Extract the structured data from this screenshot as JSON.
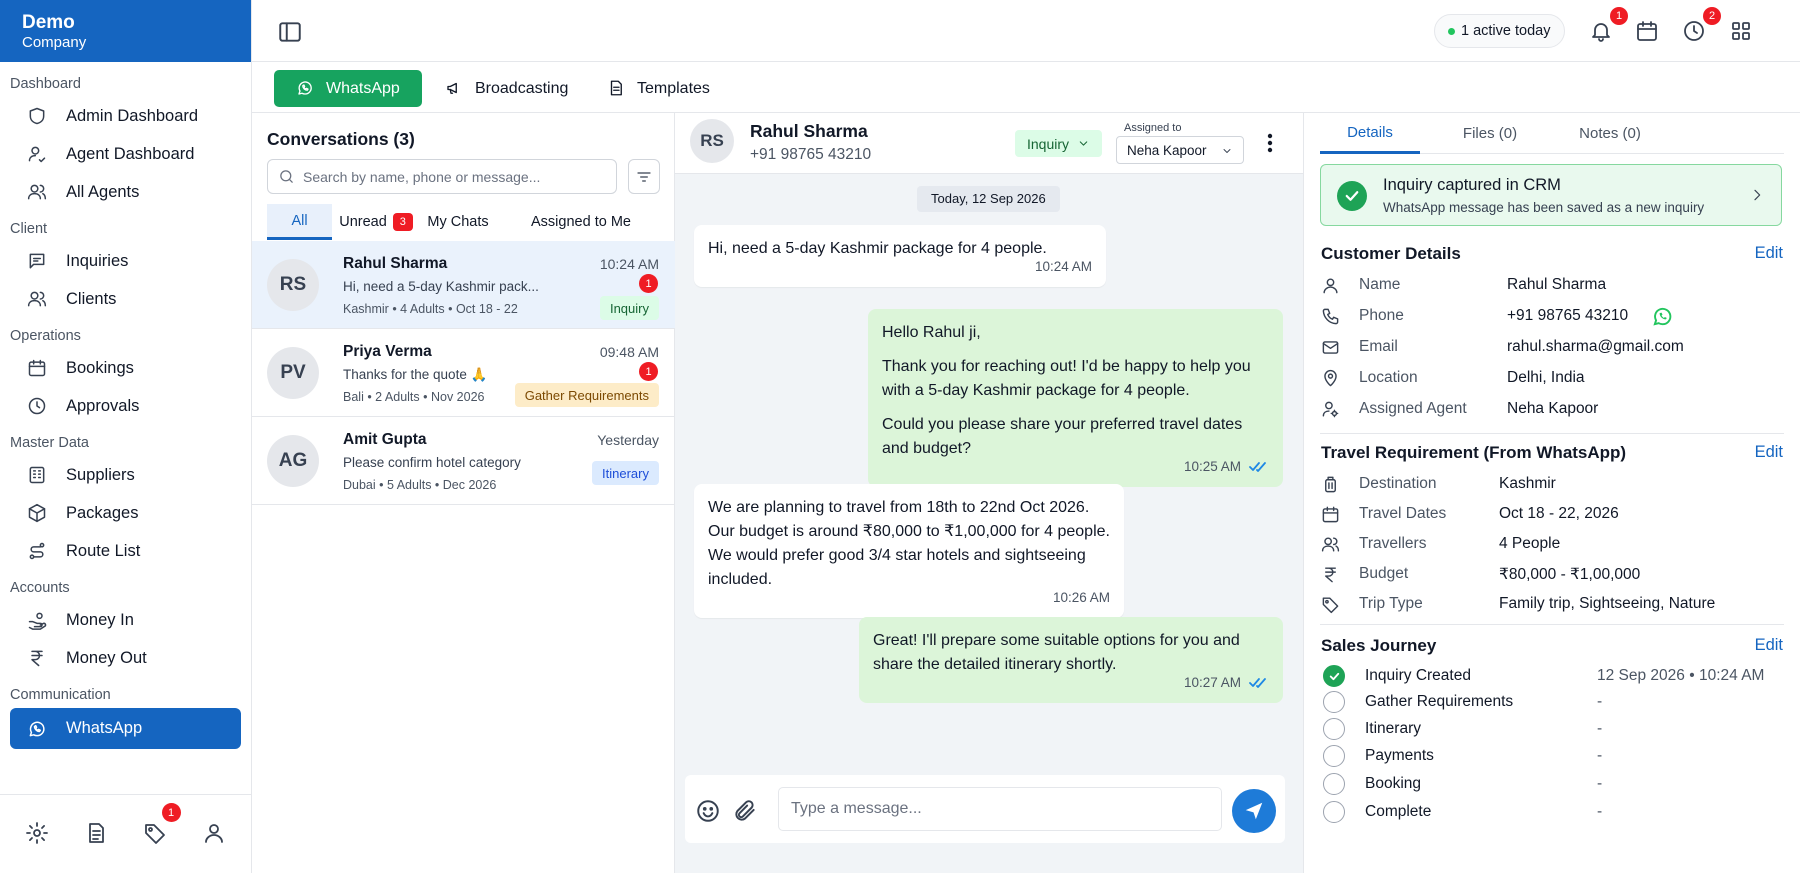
{
  "brand": {
    "line1": "Demo",
    "line2": "Company"
  },
  "sidebar": {
    "groups": [
      {
        "label": "Dashboard",
        "items": [
          {
            "label": "Admin Dashboard",
            "icon": "shield-icon"
          },
          {
            "label": "Agent Dashboard",
            "icon": "user-icon"
          },
          {
            "label": "All Agents",
            "icon": "users-icon"
          }
        ]
      },
      {
        "label": "Client",
        "items": [
          {
            "label": "Inquiries",
            "icon": "message-square-icon"
          },
          {
            "label": "Clients",
            "icon": "users-icon"
          }
        ]
      },
      {
        "label": "Operations",
        "items": [
          {
            "label": "Bookings",
            "icon": "calendar-icon"
          },
          {
            "label": "Approvals",
            "icon": "clock-icon"
          }
        ]
      },
      {
        "label": "Master Data",
        "items": [
          {
            "label": "Suppliers",
            "icon": "building-icon"
          },
          {
            "label": "Packages",
            "icon": "package-icon"
          },
          {
            "label": "Route List",
            "icon": "route-icon"
          }
        ]
      },
      {
        "label": "Accounts",
        "items": [
          {
            "label": "Money In",
            "icon": "hand-coins-icon"
          },
          {
            "label": "Money Out",
            "icon": "rupee-icon"
          }
        ]
      },
      {
        "label": "Communication",
        "items": [
          {
            "label": "WhatsApp",
            "icon": "whatsapp-icon",
            "active": true
          }
        ]
      }
    ],
    "footer": {
      "tags_badge": "1"
    }
  },
  "topbar": {
    "active_today": "1 active today",
    "notifications_badge": "1",
    "history_badge": "2"
  },
  "channel_tabs": [
    {
      "label": "WhatsApp",
      "active": true
    },
    {
      "label": "Broadcasting"
    },
    {
      "label": "Templates"
    }
  ],
  "conversations": {
    "title": "Conversations (3)",
    "search_placeholder": "Search by name, phone or message...",
    "filters": {
      "all": "All",
      "unread": "Unread",
      "unread_count": "3",
      "my_chats": "My Chats",
      "assigned": "Assigned to Me"
    },
    "items": [
      {
        "initials": "RS",
        "name": "Rahul Sharma",
        "time": "10:24 AM",
        "preview": "Hi, need a 5-day Kashmir pack...",
        "meta": "Kashmir • 4 Adults • Oct 18 - 22",
        "unread": "1",
        "stage": "Inquiry"
      },
      {
        "initials": "PV",
        "name": "Priya Verma",
        "time": "09:48 AM",
        "preview": "Thanks for the quote 🙏",
        "meta": "Bali • 2 Adults • Nov 2026",
        "unread": "1",
        "stage": "Gather Requirements"
      },
      {
        "initials": "AG",
        "name": "Amit Gupta",
        "time": "Yesterday",
        "preview": "Please confirm hotel category",
        "meta": "Dubai • 5 Adults • Dec 2026",
        "stage": "Itinerary"
      }
    ]
  },
  "chat": {
    "initials": "RS",
    "name": "Rahul Sharma",
    "phone": "+91 98765 43210",
    "status": "Inquiry",
    "assigned_label": "Assigned to",
    "assigned_to": "Neha Kapoor",
    "date_chip": "Today, 12 Sep 2026",
    "messages": [
      {
        "dir": "in",
        "paras": [
          "Hi, need a 5-day Kashmir package for 4 people."
        ],
        "time": "10:24 AM"
      },
      {
        "dir": "out",
        "paras": [
          "Hello Rahul ji,",
          "Thank you for reaching out! I'd be happy to help you with a 5-day Kashmir package for 4 people.",
          "Could you please share your preferred travel dates and budget?"
        ],
        "time": "10:25 AM"
      },
      {
        "dir": "in",
        "paras": [
          "We are planning to travel from 18th to 22nd Oct 2026. Our budget is around ₹80,000 to ₹1,00,000 for 4 people. We would prefer good 3/4 star hotels and sightseeing included."
        ],
        "time": "10:26 AM"
      },
      {
        "dir": "out",
        "paras": [
          "Great! I'll prepare some suitable options for you and share the detailed itinerary shortly."
        ],
        "time": "10:27 AM"
      }
    ],
    "input_placeholder": "Type a message..."
  },
  "details": {
    "tabs": [
      "Details",
      "Files (0)",
      "Notes (0)"
    ],
    "crm": {
      "title": "Inquiry captured in CRM",
      "subtitle": "WhatsApp message has been saved as a new inquiry"
    },
    "customer": {
      "title": "Customer Details",
      "edit": "Edit",
      "rows": [
        {
          "key": "Name",
          "value": "Rahul Sharma",
          "icon": "user-icon"
        },
        {
          "key": "Phone",
          "value": "+91 98765 43210",
          "icon": "phone-icon"
        },
        {
          "key": "Email",
          "value": "rahul.sharma@gmail.com",
          "icon": "mail-icon"
        },
        {
          "key": "Location",
          "value": "Delhi, India",
          "icon": "map-pin-icon"
        },
        {
          "key": "Assigned Agent",
          "value": "Neha Kapoor",
          "icon": "user-cog-icon"
        }
      ]
    },
    "travel": {
      "title": "Travel Requirement (From WhatsApp)",
      "edit": "Edit",
      "rows": [
        {
          "key": "Destination",
          "value": "Kashmir",
          "icon": "luggage-icon"
        },
        {
          "key": "Travel Dates",
          "value": "Oct 18 - 22, 2026",
          "icon": "calendar-icon"
        },
        {
          "key": "Travellers",
          "value": "4 People",
          "icon": "users-icon"
        },
        {
          "key": "Budget",
          "value": "₹80,000 - ₹1,00,000",
          "icon": "rupee-icon"
        },
        {
          "key": "Trip Type",
          "value": "Family trip, Sightseeing, Nature",
          "icon": "tag-icon"
        }
      ]
    },
    "journey": {
      "title": "Sales Journey",
      "edit": "Edit",
      "steps": [
        {
          "name": "Inquiry Created",
          "date": "12 Sep 2026 • 10:24 AM",
          "done": true
        },
        {
          "name": "Gather Requirements",
          "date": "-"
        },
        {
          "name": "Itinerary",
          "date": "-"
        },
        {
          "name": "Payments",
          "date": "-"
        },
        {
          "name": "Booking",
          "date": "-"
        },
        {
          "name": "Complete",
          "date": "-"
        }
      ]
    }
  }
}
